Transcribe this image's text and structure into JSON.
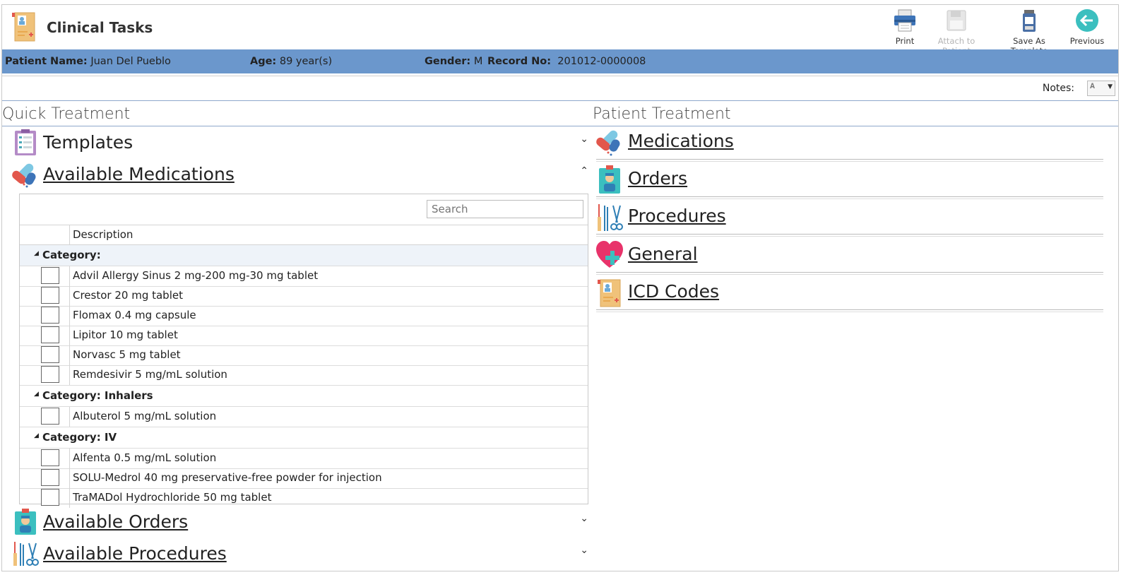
{
  "app": {
    "title": "Clinical Tasks"
  },
  "toolbar": {
    "print": "Print",
    "attach": "Attach to Patient",
    "save_template": "Save As Template",
    "previous": "Previous"
  },
  "patient": {
    "name_label": "Patient Name:",
    "name": "Juan Del Pueblo",
    "age_label": "Age:",
    "age": "89 year(s)",
    "gender_label": "Gender:",
    "gender": "M",
    "record_label": "Record No:",
    "record": "201012-0000008"
  },
  "notes": {
    "label": "Notes:"
  },
  "quick": {
    "title": "Quick Treatment",
    "templates": "Templates",
    "available_medications": "Available Medications",
    "available_orders": "Available Orders",
    "available_procedures": "Available Procedures",
    "search_placeholder": "Search",
    "col_description": "Description",
    "groups": [
      {
        "label": "Category:",
        "items": [
          "Advil Allergy Sinus 2 mg-200 mg-30 mg tablet",
          "Crestor 20 mg tablet",
          "Flomax 0.4 mg capsule",
          "Lipitor 10 mg tablet",
          "Norvasc 5 mg tablet",
          "Remdesivir 5 mg/mL solution"
        ]
      },
      {
        "label": "Category: Inhalers",
        "items": [
          "Albuterol 5 mg/mL solution"
        ]
      },
      {
        "label": "Category: IV",
        "items": [
          "Alfenta 0.5 mg/mL solution",
          "SOLU-Medrol 40 mg preservative-free powder for injection",
          "TraMADol Hydrochloride 50 mg tablet"
        ]
      }
    ]
  },
  "patient_treatment": {
    "title": "Patient Treatment",
    "sections": [
      "Medications",
      "Orders",
      "Procedures",
      "General",
      "ICD Codes"
    ]
  }
}
